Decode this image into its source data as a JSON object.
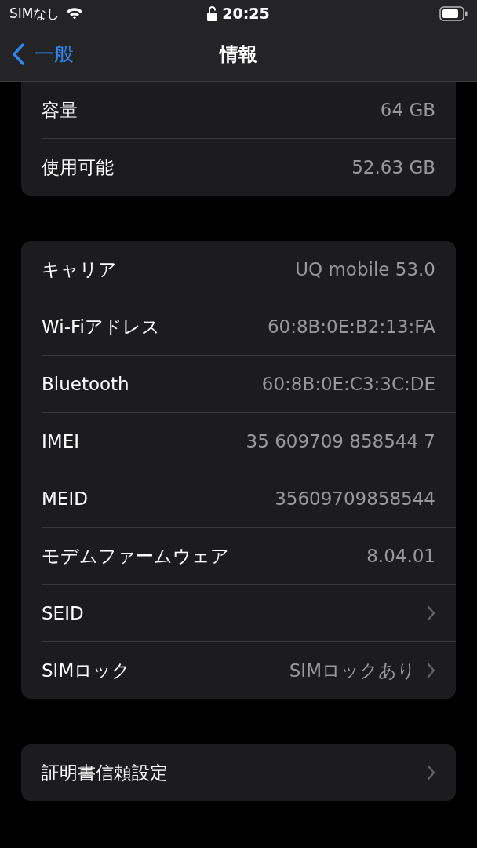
{
  "status_bar": {
    "carrier": "SIMなし",
    "time": "20:25"
  },
  "nav": {
    "back": "一般",
    "title": "情報"
  },
  "groups": [
    {
      "cut_top": true,
      "rows": [
        {
          "kind": "detail",
          "label": "容量",
          "value": "64 GB"
        },
        {
          "kind": "detail",
          "label": "使用可能",
          "value": "52.63 GB"
        }
      ]
    },
    {
      "cut_top": false,
      "rows": [
        {
          "kind": "detail",
          "label": "キャリア",
          "value": "UQ mobile 53.0"
        },
        {
          "kind": "detail",
          "label": "Wi-Fiアドレス",
          "value": "60:8B:0E:B2:13:FA"
        },
        {
          "kind": "detail",
          "label": "Bluetooth",
          "value": "60:8B:0E:C3:3C:DE"
        },
        {
          "kind": "detail",
          "label": "IMEI",
          "value": "35 609709 858544 7"
        },
        {
          "kind": "detail",
          "label": "MEID",
          "value": "35609709858544"
        },
        {
          "kind": "detail",
          "label": "モデムファームウェア",
          "value": "8.04.01"
        },
        {
          "kind": "link",
          "label": "SEID"
        },
        {
          "kind": "link",
          "label": "SIMロック",
          "value": "SIMロックあり"
        }
      ]
    },
    {
      "cut_top": false,
      "rows": [
        {
          "kind": "link",
          "label": "証明書信頼設定"
        }
      ]
    }
  ]
}
